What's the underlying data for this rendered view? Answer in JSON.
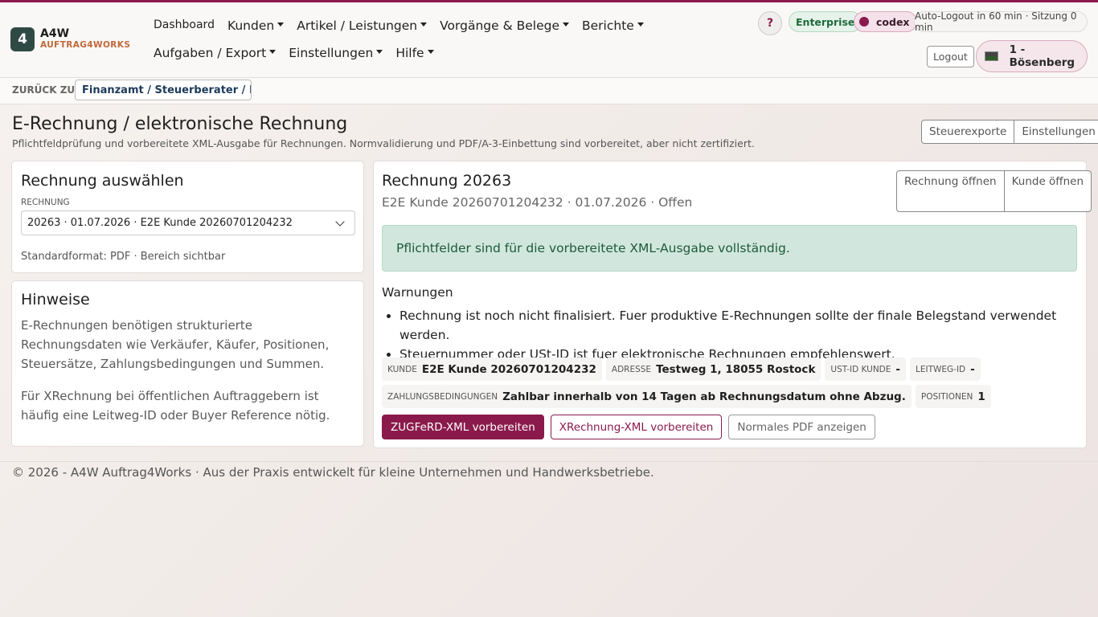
{
  "brand": {
    "logo": "4",
    "title": "A4W",
    "subtitle": "AUFTRAG4WORKS"
  },
  "nav": {
    "row1": [
      "Dashboard",
      "Kunden",
      "Artikel / Leistungen",
      "Vorgänge & Belege",
      "Berichte"
    ],
    "row2": [
      "Aufgaben / Export",
      "Einstellungen",
      "Hilfe"
    ]
  },
  "header": {
    "help": "?",
    "plan_badge": "Enterprise",
    "user_badge": "codex",
    "session": "Auto-Logout in 60 min · Sitzung 0 min",
    "logout": "Logout",
    "company": "1 - Bösenberg"
  },
  "breadcrumb": {
    "label": "ZURÜCK ZU",
    "target": "Finanzamt / Steuerberater / Ex..."
  },
  "page": {
    "title": "E-Rechnung / elektronische Rechnung",
    "subtitle": "Pflichtfeldprüfung und vorbereitete XML-Ausgabe für Rechnungen. Normvalidierung und PDF/A-3-Einbettung sind vorbereitet, aber nicht zertifiziert.",
    "btn_tax": "Steuerexporte",
    "btn_settings": "Einstellungen"
  },
  "select_card": {
    "title": "Rechnung auswählen",
    "label": "RECHNUNG",
    "value": "20263 · 01.07.2026 · E2E Kunde 20260701204232",
    "note": "Standardformat: PDF · Bereich sichtbar"
  },
  "hints": {
    "title": "Hinweise",
    "p1": "E-Rechnungen benötigen strukturierte Rechnungsdaten wie Verkäufer, Käufer, Positionen, Steuersätze, Zahlungsbedingungen und Summen.",
    "p2": "Für XRechnung bei öffentlichen Auftraggebern ist häufig eine Leitweg-ID oder Buyer Reference nötig."
  },
  "invoice": {
    "title": "Rechnung 20263",
    "meta": "E2E Kunde 20260701204232 · 01.07.2026 · Offen",
    "btn_open_invoice": "Rechnung öffnen",
    "btn_open_customer": "Kunde öffnen",
    "success": "Pflichtfelder sind für die vorbereitete XML-Ausgabe vollständig.",
    "warnings_title": "Warnungen",
    "warnings": [
      "Rechnung ist noch nicht finalisiert. Fuer produktive E-Rechnungen sollte der finale Belegstand verwendet werden.",
      "Steuernummer oder USt-ID ist fuer elektronische Rechnungen empfehlenswert."
    ],
    "fields": {
      "kunde_k": "KUNDE",
      "kunde_v": "E2E Kunde 20260701204232",
      "adresse_k": "ADRESSE",
      "adresse_v": "Testweg 1, 18055 Rostock",
      "ustid_k": "UST-ID KUNDE",
      "ustid_v": "-",
      "leitweg_k": "LEITWEG-ID",
      "leitweg_v": "-",
      "zahlung_k": "ZAHLUNGSBEDINGUNGEN",
      "zahlung_v": "Zahlbar innerhalb von 14 Tagen ab Rechnungsdatum ohne Abzug.",
      "positionen_k": "POSITIONEN",
      "positionen_v": "1"
    },
    "btn_zugferd": "ZUGFeRD-XML vorbereiten",
    "btn_xrechnung": "XRechnung-XML vorbereiten",
    "btn_pdf": "Normales PDF anzeigen"
  },
  "footer": "© 2026 - A4W Auftrag4Works · Aus der Praxis entwickelt für kleine Unternehmen und Handwerksbetriebe.",
  "colors": {
    "brand": "#8a1a4c",
    "success_bg": "#d1e7dd",
    "logo_bg": "#2f4a44"
  }
}
